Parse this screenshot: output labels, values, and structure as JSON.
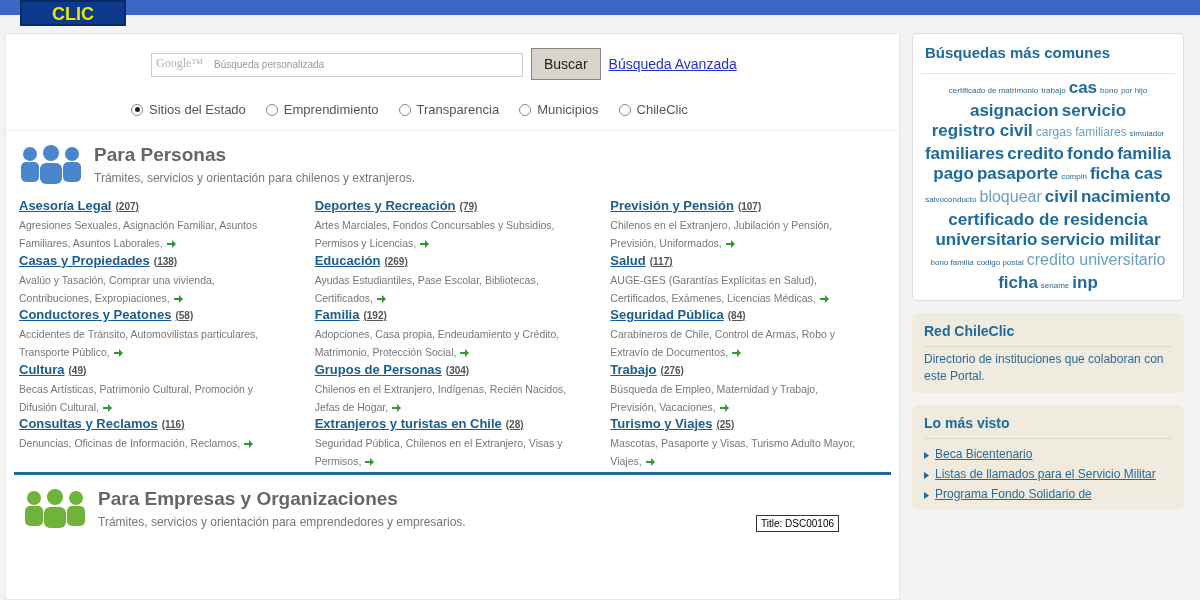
{
  "logo": {
    "text": "CLIC"
  },
  "search": {
    "brand": "Google™",
    "placeholder": "Búsqueda personalizada",
    "button": "Buscar",
    "advanced_link": "Búsqueda Avanzada"
  },
  "scopes": [
    {
      "label": "Sitios del Estado",
      "selected": true
    },
    {
      "label": "Emprendimiento",
      "selected": false
    },
    {
      "label": "Transparencia",
      "selected": false
    },
    {
      "label": "Municipios",
      "selected": false
    },
    {
      "label": "ChileClic",
      "selected": false
    }
  ],
  "personas": {
    "title": "Para Personas",
    "subtitle": "Trámites, servicios y orientación para chilenos y extranjeros.",
    "categories": [
      {
        "name": "Asesoría Legal",
        "count": "(207)",
        "description": "Agresiones Sexuales, Asignación Familiar, Asuntos Familiares, Asuntos Laborales,"
      },
      {
        "name": "Casas y Propiedades",
        "count": "(138)",
        "description": "Avalúo y Tasación, Comprar una vivienda, Contribuciones, Expropiaciones,"
      },
      {
        "name": "Conductores y Peatones",
        "count": "(58)",
        "description": "Accidentes de Tránsito, Automovilistas particulares, Transporte Público,"
      },
      {
        "name": "Cultura",
        "count": "(49)",
        "description": "Becas Artísticas, Patrimonio Cultural, Promoción y Difusión Cultural,"
      },
      {
        "name": "Consultas y Reclamos",
        "count": "(116)",
        "description": "Denuncias, Oficinas de Información, Reclamos,"
      },
      {
        "name": "Deportes y Recreación",
        "count": "(79)",
        "description": "Artes Marciales, Fondos Concursables y Subsidios, Permisos y Licencias,"
      },
      {
        "name": "Educación",
        "count": "(269)",
        "description": "Ayudas Estudiantiles, Pase Escolar, Bibliotecas, Certificados,"
      },
      {
        "name": "Familia",
        "count": "(192)",
        "description": "Adopciones, Casa propia, Endeudamiento y Crédito, Matrimonio, Protección Social,"
      },
      {
        "name": "Grupos de Personas",
        "count": "(304)",
        "description": "Chilenos en el Extranjero, Indígenas, Recién Nacidos, Jefas de Hogar,"
      },
      {
        "name": "Extranjeros y turistas en Chile",
        "count": "(28)",
        "description": "Seguridad Pública, Chilenos en el Extranjero, Visas y Permisos,"
      },
      {
        "name": "Previsión y Pensión",
        "count": "(107)",
        "description": "Chilenos en el Extranjero, Jubilación y Pensión, Previsión, Uniformados,"
      },
      {
        "name": "Salud",
        "count": "(117)",
        "description": "AUGE-GES (Garantías Explícitas en Salud), Certificados, Exámenes, Licencias Médicas,"
      },
      {
        "name": "Seguridad Pública",
        "count": "(84)",
        "description": "Carabineros de Chile, Control de Armas, Robo y Extravío de Documentos,"
      },
      {
        "name": "Trabajo",
        "count": "(276)",
        "description": "Búsqueda de Empleo, Maternidad y Trabajo, Previsión, Vacaciones,"
      },
      {
        "name": "Turismo y Viajes",
        "count": "(25)",
        "description": "Mascotas, Pasaporte y Visas, Turismo Adulto Mayor, Viajes,"
      }
    ]
  },
  "empresas": {
    "title": "Para Empresas y Organizaciones",
    "subtitle": "Trámites, servicios y orientación para emprendedores y empresarios."
  },
  "tooltip": "Title: DSC00106",
  "tag_cloud": {
    "title": "Búsquedas más comunes",
    "tags": [
      {
        "text": "certificado de matrimonio",
        "kind": "small"
      },
      {
        "text": "trabajo",
        "kind": "small"
      },
      {
        "text": "cas",
        "kind": "large"
      },
      {
        "text": "bono",
        "kind": "small"
      },
      {
        "text": "por hijo",
        "kind": "small"
      },
      {
        "text": "asignacion",
        "kind": "large"
      },
      {
        "text": "servicio",
        "kind": "large"
      },
      {
        "text": "registro civil",
        "kind": "large"
      },
      {
        "text": "cargas familiares",
        "kind": "light"
      },
      {
        "text": "simulador",
        "kind": "small"
      },
      {
        "text": "familiares",
        "kind": "large"
      },
      {
        "text": "credito",
        "kind": "large"
      },
      {
        "text": "fondo",
        "kind": "large"
      },
      {
        "text": "familia",
        "kind": "large"
      },
      {
        "text": "pago",
        "kind": "large"
      },
      {
        "text": "pasaporte",
        "kind": "large"
      },
      {
        "text": "compin",
        "kind": "small"
      },
      {
        "text": "ficha cas",
        "kind": "large"
      },
      {
        "text": "salvoconducto",
        "kind": "small"
      },
      {
        "text": "bloquear",
        "kind": "light-large"
      },
      {
        "text": "civil",
        "kind": "large"
      },
      {
        "text": "nacimiento",
        "kind": "large"
      },
      {
        "text": "certificado de residencia",
        "kind": "large"
      },
      {
        "text": "universitario",
        "kind": "large"
      },
      {
        "text": "servicio militar",
        "kind": "large"
      },
      {
        "text": "bono familia",
        "kind": "small"
      },
      {
        "text": "codigo postal",
        "kind": "small"
      },
      {
        "text": "credito universitario",
        "kind": "light-large"
      },
      {
        "text": "ficha",
        "kind": "large"
      },
      {
        "text": "sename",
        "kind": "small"
      },
      {
        "text": "inp",
        "kind": "large"
      }
    ]
  },
  "red": {
    "title": "Red ChileClic",
    "text": "Directorio de instituciones que colaboran con este Portal."
  },
  "most_viewed": {
    "title": "Lo más visto",
    "links": [
      "Beca Bicentenario",
      "Listas de llamados para el Servicio Militar",
      "Programa Fondo Solidario de"
    ]
  }
}
